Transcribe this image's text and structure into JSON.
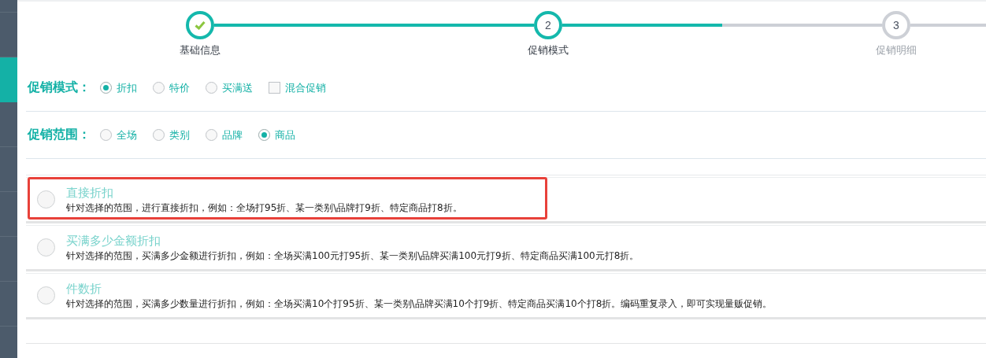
{
  "sidebar": {
    "items": [
      {
        "selected": false
      },
      {
        "selected": true
      },
      {
        "selected": false
      },
      {
        "selected": false
      },
      {
        "selected": false
      },
      {
        "selected": false
      },
      {
        "selected": false
      }
    ]
  },
  "steps": [
    {
      "label": "基础信息",
      "done": true,
      "reached": true
    },
    {
      "number": "2",
      "label": "促销模式",
      "done": false,
      "reached": true
    },
    {
      "number": "3",
      "label": "促销明细",
      "done": false,
      "reached": false
    }
  ],
  "progress": {
    "level": 0.5
  },
  "mode": {
    "label": "促销模式：",
    "options": [
      {
        "kind": "radio",
        "label": "折扣",
        "selected": true
      },
      {
        "kind": "radio",
        "label": "特价",
        "selected": false
      },
      {
        "kind": "radio",
        "label": "买满送",
        "selected": false
      },
      {
        "kind": "checkbox",
        "label": "混合促销",
        "checked": false
      }
    ]
  },
  "scope": {
    "label": "促销范围：",
    "options": [
      {
        "kind": "radio",
        "label": "全场",
        "selected": false
      },
      {
        "kind": "radio",
        "label": "类别",
        "selected": false
      },
      {
        "kind": "radio",
        "label": "品牌",
        "selected": false
      },
      {
        "kind": "radio",
        "label": "商品",
        "selected": true
      }
    ]
  },
  "discount_types": [
    {
      "title": "直接折扣",
      "description": "针对选择的范围，进行直接折扣，例如：全场打95折、某一类别\\品牌打9折、特定商品打8折。",
      "selected": false,
      "highlighted": true
    },
    {
      "title": "买满多少金额折扣",
      "description": "针对选择的范围，买满多少金额进行折扣，例如：全场买满100元打95折、某一类别\\品牌买满100元打9折、特定商品买满100元打8折。",
      "selected": false,
      "highlighted": false
    },
    {
      "title": "件数折",
      "description": "针对选择的范围，买满多少数量进行折扣，例如：全场买满10个打95折、某一类别\\品牌买满10个打9折、特定商品买满10个打8折。编码重复录入，即可实现量贩促销。",
      "selected": false,
      "highlighted": false
    }
  ]
}
